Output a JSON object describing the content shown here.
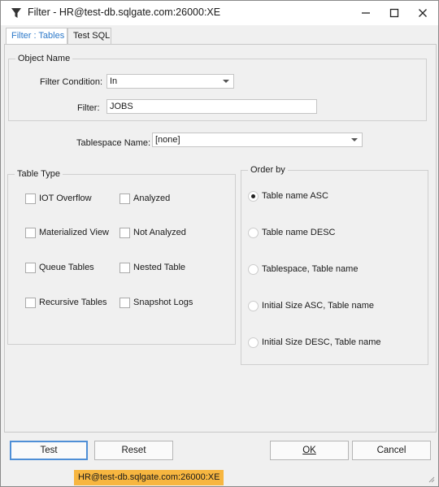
{
  "window": {
    "title": "Filter  -  HR@test-db.sqlgate.com:26000:XE"
  },
  "tabs": [
    {
      "label": "Filter : Tables",
      "active": true
    },
    {
      "label": "Test SQL",
      "active": false
    }
  ],
  "object_name": {
    "group_label": "Object Name",
    "filter_condition_label": "Filter Condition:",
    "filter_condition_value": "In",
    "filter_label": "Filter:",
    "filter_value": "JOBS"
  },
  "tablespace": {
    "label": "Tablespace Name:",
    "value": "[none]"
  },
  "table_type": {
    "group_label": "Table Type",
    "items": [
      {
        "label": "IOT Overflow",
        "checked": false
      },
      {
        "label": "Analyzed",
        "checked": false
      },
      {
        "label": "Materialized View",
        "checked": false
      },
      {
        "label": "Not Analyzed",
        "checked": false
      },
      {
        "label": "Queue Tables",
        "checked": false
      },
      {
        "label": "Nested Table",
        "checked": false
      },
      {
        "label": "Recursive Tables",
        "checked": false
      },
      {
        "label": "Snapshot Logs",
        "checked": false
      }
    ]
  },
  "order_by": {
    "group_label": "Order by",
    "options": [
      {
        "label": "Table name ASC",
        "checked": true
      },
      {
        "label": "Table name DESC",
        "checked": false
      },
      {
        "label": "Tablespace, Table name",
        "checked": false
      },
      {
        "label": "Initial Size ASC, Table name",
        "checked": false
      },
      {
        "label": "Initial Size DESC, Table name",
        "checked": false
      }
    ]
  },
  "buttons": {
    "test": "Test",
    "reset": "Reset",
    "ok": "OK",
    "cancel": "Cancel"
  },
  "status": {
    "connection": "HR@test-db.sqlgate.com:26000:XE"
  },
  "colors": {
    "accent": "#2b78c9",
    "status_badge": "#f7b640"
  }
}
